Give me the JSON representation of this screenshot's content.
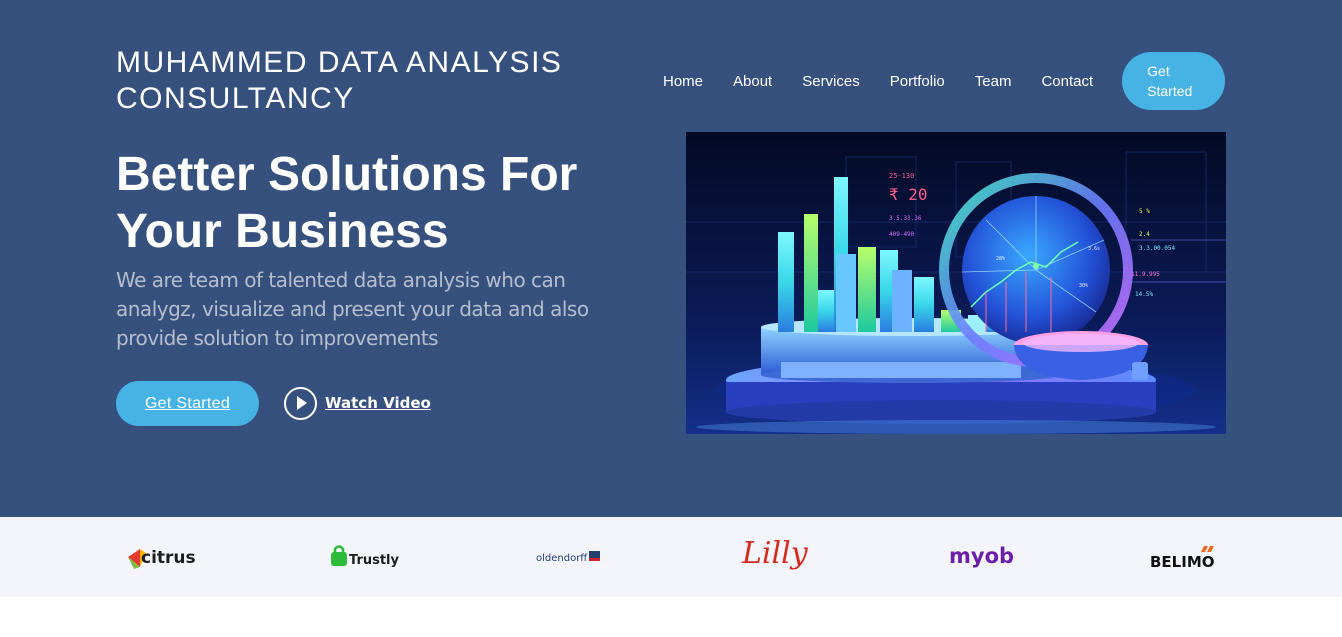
{
  "brand": {
    "name": "MUHAMMED DATA ANALYSIS CONSULTANCY"
  },
  "nav": {
    "items": [
      "Home",
      "About",
      "Services",
      "Portfolio",
      "Team",
      "Contact"
    ],
    "cta_label": "Get Started"
  },
  "hero": {
    "title": "Better Solutions For Your Business",
    "subtitle": "We are team of talented data analysis who can analygz, visualize and present your data and also provide solution to improvements",
    "get_started_label": "Get Started",
    "watch_video_label": "Watch Video",
    "image": {
      "icon": "analytics-dashboard-illustration",
      "texts": [
        "25-130",
        "₹ 20",
        "5 %",
        "2.4",
        "3.3.00.054",
        "$1.9.995",
        "14.5%"
      ]
    }
  },
  "clients": {
    "logos": [
      "citrus",
      "Trustly",
      "oldendorff",
      "Lilly",
      "myob",
      "BELIMO"
    ]
  },
  "colors": {
    "hero_bg": "#37517e",
    "accent": "#47b2e4",
    "clients_bg": "#f3f5fa"
  }
}
